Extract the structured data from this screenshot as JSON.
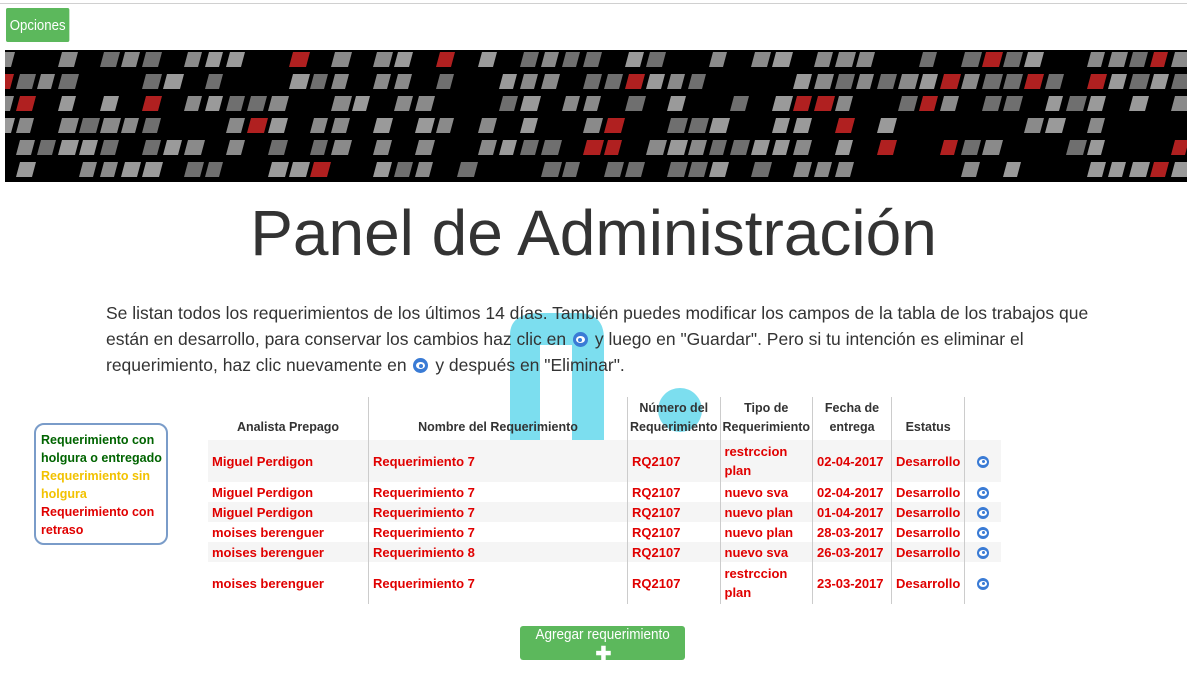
{
  "header": {
    "options_label": "Opciones"
  },
  "banner": {
    "name": "banner-pattern"
  },
  "main": {
    "title": "Panel de Administración",
    "intro": {
      "part1": "Se listan todos los requerimientos de los últimos 14 días. También puedes modificar los campos de la tabla de los trabajos que están en desarrollo, para conservar los cambios haz clic en ",
      "part2": " y luego en \"Guardar\". Pero si tu intención es eliminar el requerimiento, haz clic nuevamente en ",
      "part3": " y después en \"Eliminar\"."
    }
  },
  "legend": {
    "green": "Requerimiento con holgura o entregado",
    "yellow": "Requerimiento sin holgura",
    "red": "Requerimiento con retraso"
  },
  "table": {
    "headers": {
      "analyst": "Analista Prepago",
      "name": "Nombre del Requerimiento",
      "number": "Número del Requerimiento",
      "type": "Tipo de Requerimiento",
      "date": "Fecha de entrega",
      "status": "Estatus"
    },
    "rows": [
      {
        "analyst": "Miguel Perdigon",
        "name": "Requerimiento 7",
        "number": "RQ2107",
        "type": "restrccion plan",
        "date": "02-04-2017",
        "status": "Desarrollo"
      },
      {
        "analyst": "Miguel Perdigon",
        "name": "Requerimiento 7",
        "number": "RQ2107",
        "type": "nuevo sva",
        "date": "02-04-2017",
        "status": "Desarrollo"
      },
      {
        "analyst": "Miguel Perdigon",
        "name": "Requerimiento 7",
        "number": "RQ2107",
        "type": "nuevo plan",
        "date": "01-04-2017",
        "status": "Desarrollo"
      },
      {
        "analyst": "moises berenguer",
        "name": "Requerimiento 7",
        "number": "RQ2107",
        "type": "nuevo plan",
        "date": "28-03-2017",
        "status": "Desarrollo"
      },
      {
        "analyst": "moises berenguer",
        "name": "Requerimiento 8",
        "number": "RQ2107",
        "type": "nuevo sva",
        "date": "26-03-2017",
        "status": "Desarrollo"
      },
      {
        "analyst": "moises berenguer",
        "name": "Requerimiento 7",
        "number": "RQ2107",
        "type": "restrccion plan",
        "date": "23-03-2017",
        "status": "Desarrollo"
      }
    ],
    "row_icon": "eye-icon"
  },
  "actions": {
    "add_label": "Agregar requerimiento",
    "add_icon": "plus-icon"
  },
  "colors": {
    "button_green": "#5cb85c",
    "late_red": "#e00000",
    "ok_green": "#006400",
    "warn_yellow": "#f2c200",
    "eye_blue": "#3a7bd5"
  }
}
